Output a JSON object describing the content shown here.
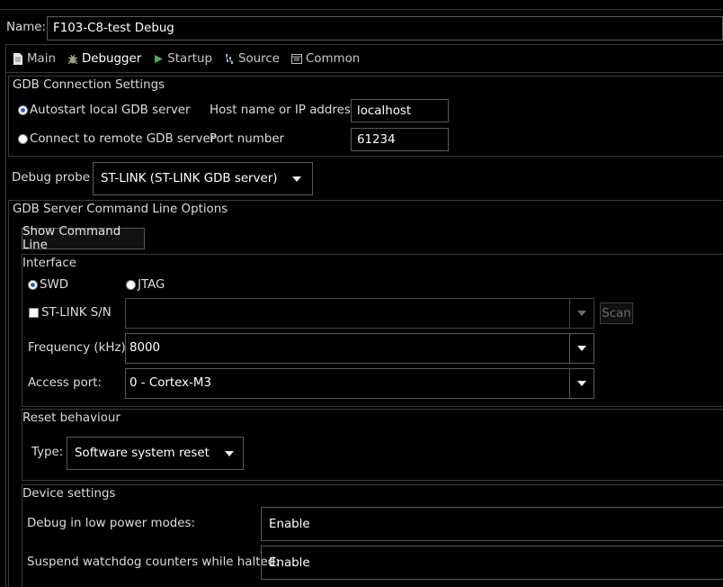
{
  "name": {
    "label": "Name:",
    "value": "F103-C8-test Debug"
  },
  "tabs": [
    {
      "label": "Main",
      "icon": "document-icon",
      "active": false
    },
    {
      "label": "Debugger",
      "icon": "bug-icon",
      "active": true
    },
    {
      "label": "Startup",
      "icon": "run-icon",
      "active": false
    },
    {
      "label": "Source",
      "icon": "source-icon",
      "active": false
    },
    {
      "label": "Common",
      "icon": "common-icon",
      "active": false
    }
  ],
  "gdb_connection": {
    "title": "GDB Connection Settings",
    "autostart_label": "Autostart local GDB server",
    "remote_label": "Connect to remote GDB server",
    "host_label": "Host name or IP address",
    "host_value": "localhost",
    "port_label": "Port number",
    "port_value": "61234"
  },
  "debug_probe": {
    "label": "Debug probe",
    "value": "ST-LINK (ST-LINK GDB server)"
  },
  "gdb_server": {
    "title": "GDB Server Command Line Options",
    "show_cmd_label": "Show Command Line",
    "interface": {
      "title": "Interface",
      "swd_label": "SWD",
      "jtag_label": "JTAG",
      "stlink_sn_label": "ST-LINK S/N",
      "stlink_sn_value": "",
      "scan_label": "Scan",
      "frequency_label": "Frequency (kHz):",
      "frequency_value": "8000",
      "access_port_label": "Access port:",
      "access_port_value": "0 - Cortex-M3"
    },
    "reset": {
      "title": "Reset behaviour",
      "type_label": "Type:",
      "type_value": "Software system reset"
    },
    "device": {
      "title": "Device settings",
      "low_power_label": "Debug in low power modes:",
      "low_power_value": "Enable",
      "watchdog_label": "Suspend watchdog counters while halted:",
      "watchdog_value": "Enable"
    }
  }
}
